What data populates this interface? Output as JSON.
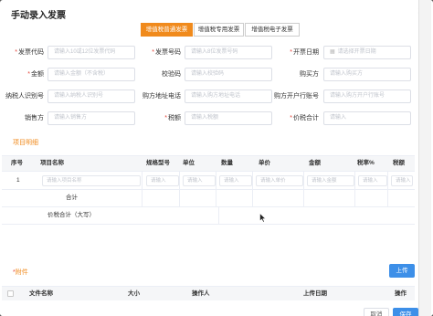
{
  "dialog": {
    "title": "手动录入发票",
    "close": "×"
  },
  "tabs": [
    {
      "label": "增值税普通发票",
      "active": true
    },
    {
      "label": "增值税专用发票",
      "active": false
    },
    {
      "label": "增值税电子发票",
      "active": false
    }
  ],
  "form": {
    "invoice_code": {
      "label": "发票代码",
      "placeholder": "请输入10或12位发票代码"
    },
    "invoice_no": {
      "label": "发票号码",
      "placeholder": "请输入8位发票号码"
    },
    "issue_date": {
      "label": "开票日期",
      "placeholder": "请选择开票日期"
    },
    "amount": {
      "label": "金额",
      "placeholder": "请输入金额（不含税）"
    },
    "check_code": {
      "label": "校验码",
      "placeholder": "请输入校验码"
    },
    "buyer": {
      "label": "购买方",
      "placeholder": "请输入购买方"
    },
    "taxpayer_id": {
      "label": "纳税人识别号",
      "placeholder": "请输入纳税人识别号"
    },
    "buyer_address": {
      "label": "购方地址电话",
      "placeholder": "请输入购方地址电话"
    },
    "buyer_bank": {
      "label": "购方开户行账号",
      "placeholder": "请输入购方开户行账号"
    },
    "seller": {
      "label": "销售方",
      "placeholder": "请输入销售方"
    },
    "tax": {
      "label": "税额",
      "placeholder": "请输入税额"
    },
    "total": {
      "label": "价税合计",
      "placeholder": "请输入"
    }
  },
  "items_section": {
    "title": "项目明细"
  },
  "items_table": {
    "headers": [
      "序号",
      "项目名称",
      "规格型号",
      "单位",
      "数量",
      "单价",
      "金额",
      "税率%",
      "税额"
    ],
    "rows": [
      {
        "index": "1",
        "name_placeholder": "请输入项目名称",
        "spec_placeholder": "请输入",
        "unit_placeholder": "请输入",
        "qty_placeholder": "请输入",
        "price_placeholder": "请输入单价",
        "amount_placeholder": "请输入金额",
        "rate_placeholder": "请输入",
        "tax_placeholder": "请输入"
      }
    ],
    "subtotal_label": "合计",
    "total_label": "价税合计（大写）"
  },
  "attachments": {
    "title": "附件",
    "upload_button": "上传",
    "headers": [
      "文件名称",
      "大小",
      "操作人",
      "上传日期",
      "操作"
    ]
  },
  "footer": {
    "cancel": "取消",
    "save": "保存"
  },
  "colors": {
    "accent": "#f08a1c",
    "primary": "#3d8fe8",
    "required": "#e4453a"
  }
}
